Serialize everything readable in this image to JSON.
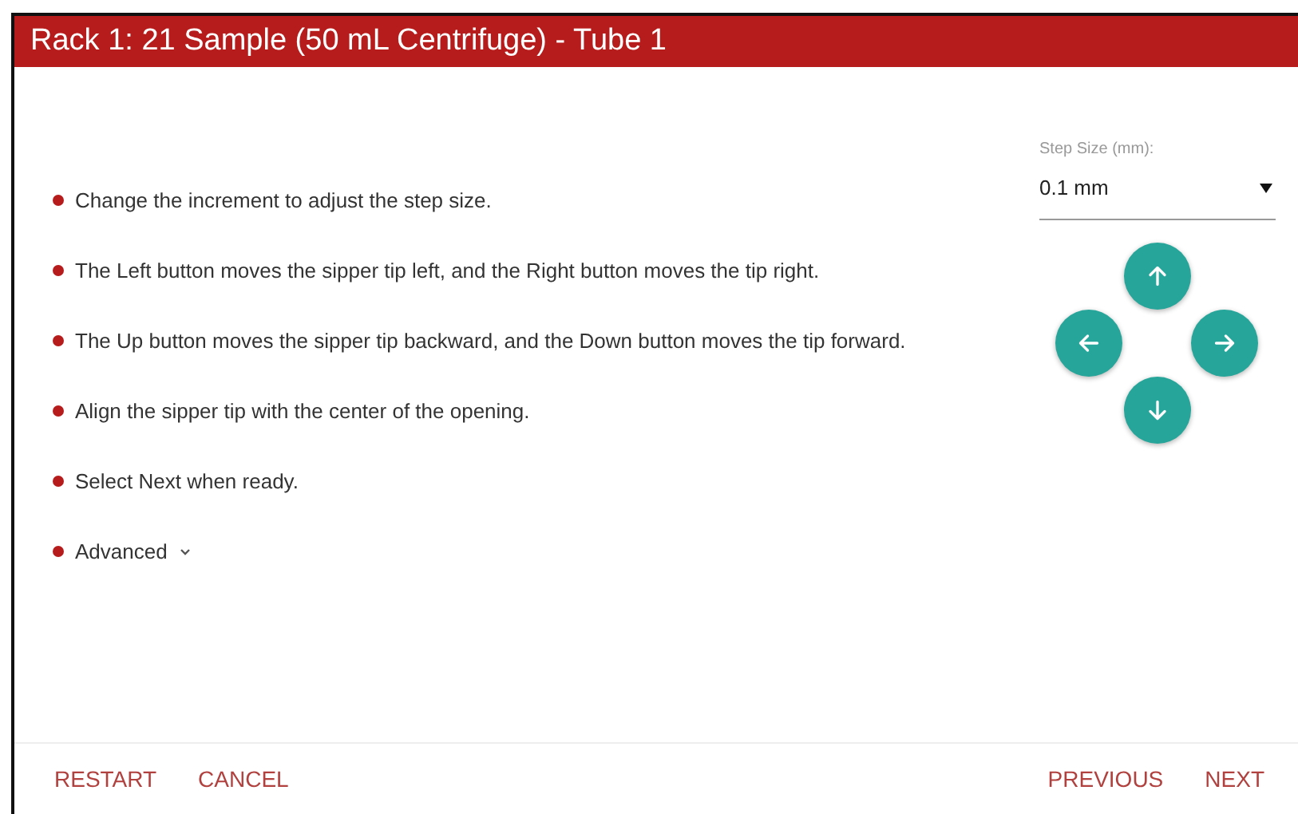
{
  "dialog": {
    "title": "Rack 1: 21 Sample (50 mL Centrifuge) - Tube 1"
  },
  "instructions": [
    {
      "kind": "text",
      "text": "Change the increment to adjust the step size."
    },
    {
      "kind": "text",
      "text": "The Left button moves the sipper tip left, and the Right button moves the tip right."
    },
    {
      "kind": "text",
      "text": "The Up button moves the sipper tip backward, and the Down button moves the tip forward."
    },
    {
      "kind": "text",
      "text": "Align the sipper tip with the center of the opening."
    },
    {
      "kind": "text",
      "text": "Select Next when ready."
    },
    {
      "kind": "expander",
      "text": "Advanced",
      "expanded": false
    }
  ],
  "step_size": {
    "label": "Step Size (mm):",
    "value": "0.1 mm"
  },
  "footer": {
    "left_buttons": [
      "RESTART",
      "CANCEL"
    ],
    "right_buttons": [
      "PREVIOUS",
      "NEXT"
    ]
  }
}
